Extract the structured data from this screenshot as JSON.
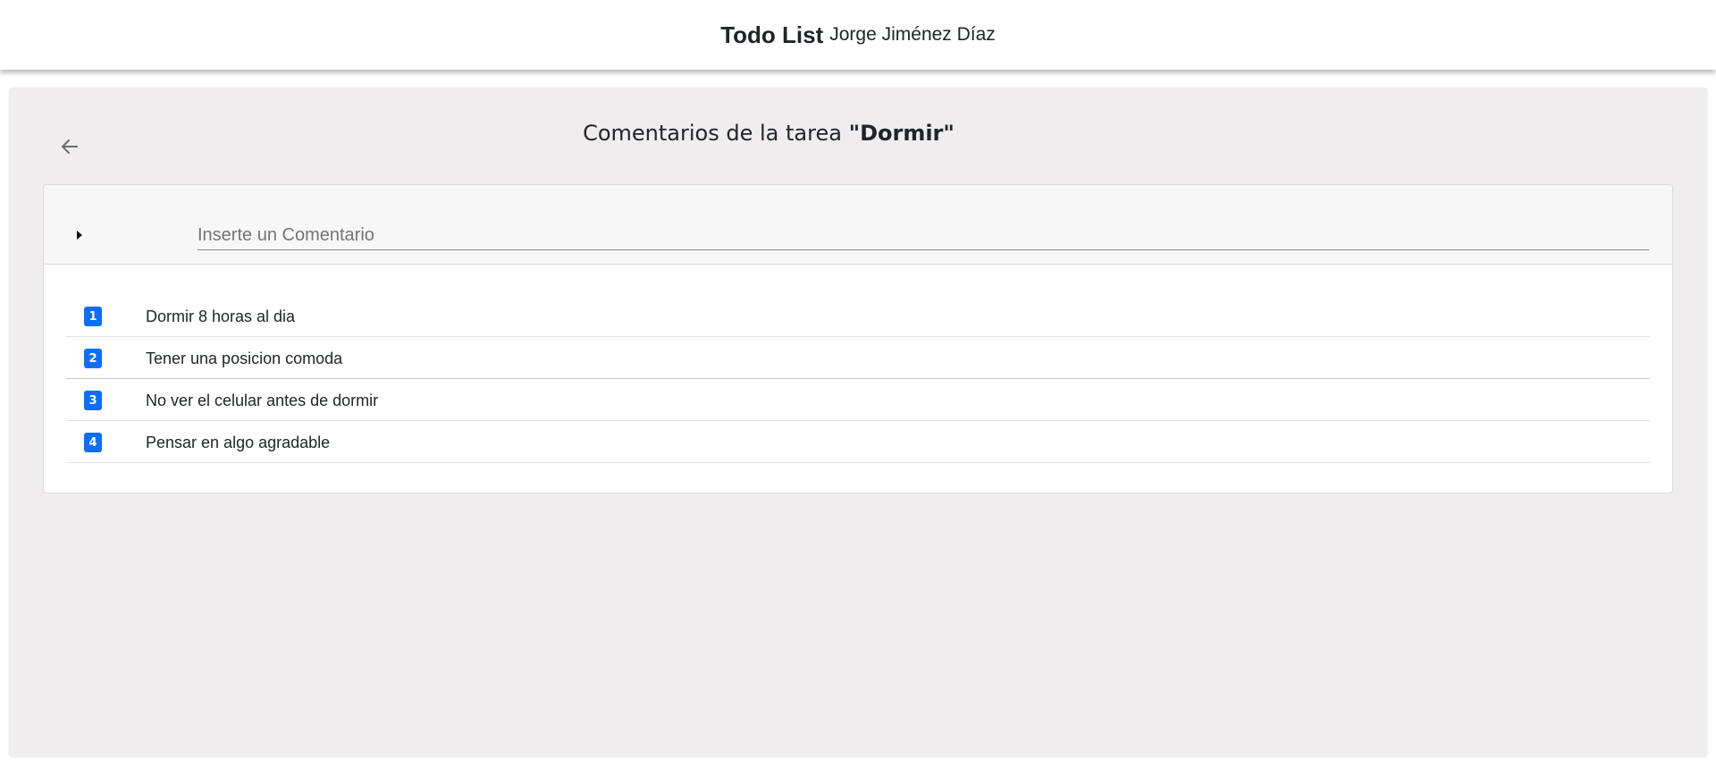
{
  "header": {
    "app_title": "Todo List",
    "user_name": "Jorge Jiménez Díaz"
  },
  "page": {
    "heading_prefix": "Comentarios de la tarea ",
    "task_name": "\"Dormir\"",
    "back_icon": "arrow-left-icon"
  },
  "comment_form": {
    "toggle_icon": "caret-right-icon",
    "input_value": "",
    "placeholder": "Inserte un Comentario"
  },
  "comments": [
    {
      "number": "1",
      "text": "Dormir 8 horas al dia"
    },
    {
      "number": "2",
      "text": "Tener una posicion comoda"
    },
    {
      "number": "3",
      "text": "No ver el celular antes de dormir"
    },
    {
      "number": "4",
      "text": "Pensar en algo agradable"
    }
  ],
  "colors": {
    "badge": "#0d6efd",
    "panel_background": "#efeded",
    "card_header_background": "#f7f7f7"
  }
}
